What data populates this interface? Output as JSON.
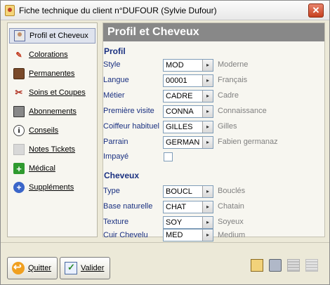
{
  "window": {
    "title": "Fiche technique du client n°DUFOUR (Sylvie Dufour)",
    "close": "✕"
  },
  "sidebar": {
    "items": [
      {
        "label": "Profil et Cheveux",
        "icon": "profile-icon"
      },
      {
        "label": "Colorations",
        "icon": "color-palette-icon"
      },
      {
        "label": "Permanentes",
        "icon": "hair-photo-icon"
      },
      {
        "label": "Soins et Coupes",
        "icon": "scissors-icon"
      },
      {
        "label": "Abonnements",
        "icon": "subscription-icon"
      },
      {
        "label": "Conseils",
        "icon": "info-icon"
      },
      {
        "label": "Notes Tickets",
        "icon": "notes-icon"
      },
      {
        "label": "Médical",
        "icon": "medical-cross-icon"
      },
      {
        "label": "Suppléments",
        "icon": "plus-icon"
      }
    ],
    "glyphs": {
      "color": "✎",
      "soins": "✂",
      "conseils": "i",
      "medical": "+",
      "supp": "+"
    }
  },
  "panel": {
    "header": "Profil et Cheveux",
    "profil": {
      "title": "Profil",
      "fields": [
        {
          "label": "Style",
          "value": "MOD",
          "desc": "Moderne"
        },
        {
          "label": "Langue",
          "value": "00001",
          "desc": "Français"
        },
        {
          "label": "Métier",
          "value": "CADRE",
          "desc": "Cadre"
        },
        {
          "label": "Première visite",
          "value": "CONNA",
          "desc": "Connaissance"
        },
        {
          "label": "Coiffeur habituel",
          "value": "GILLES",
          "desc": "Gilles"
        },
        {
          "label": "Parrain",
          "value": "GERMAN",
          "desc": "Fabien germanaz"
        }
      ],
      "impaye_label": "Impayé",
      "impaye_checked": false
    },
    "cheveux": {
      "title": "Cheveux",
      "fields": [
        {
          "label": "Type",
          "value": "BOUCL",
          "desc": "Bouclés"
        },
        {
          "label": "Base naturelle",
          "value": "CHAT",
          "desc": "Chatain"
        },
        {
          "label": "Texture",
          "value": "SOY",
          "desc": "Soyeux"
        },
        {
          "label": "Cuir Chevelu",
          "value": "MED",
          "desc": "Medium"
        }
      ]
    },
    "combo_arrow": "▸"
  },
  "footer": {
    "quit_label": "Quitter",
    "validate_label": "Valider"
  },
  "colors": {
    "header_bg": "#888888",
    "label_blue": "#1a3080",
    "desc_gray": "#808080"
  }
}
